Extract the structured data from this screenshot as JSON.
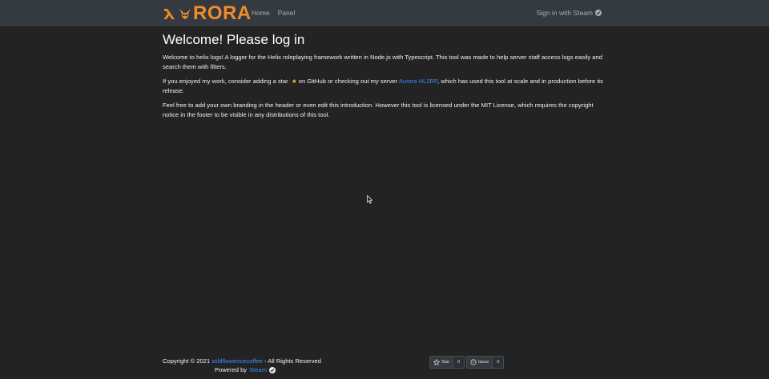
{
  "colors": {
    "accent": "#f28c28",
    "link": "#3d8bfd",
    "background": "#232323",
    "navbar": "#343a40"
  },
  "nav": {
    "brand": "RORA",
    "links": [
      {
        "label": "Home"
      },
      {
        "label": "Panel"
      }
    ],
    "signin_label": "Sign in with Steam"
  },
  "main": {
    "title": "Welcome! Please log in",
    "p1": "Welcome to helix logs! A logger for the Helix roleplaying framework written in Node.js with Typescript. This tool was made to help server staff access logs easily and search them with filters.",
    "p2_before": "If you enjoyed my work, consider adding a star",
    "p2_star": "★",
    "p2_middle": " on GitHub or checking out my server ",
    "p2_link": "Aurora HL2RP",
    "p2_after": ", which has used this tool at scale and in production before its release.",
    "p3": "Feel free to add your own branding in the header or even edit this introduction. However this tool is licensed under the MIT License, which requires the copyright notice in the footer to be visible in any distributions of this tool."
  },
  "footer": {
    "copyright_prefix": "Copyright © 2021 ",
    "author_link": "wildflowericecoffee",
    "copyright_suffix": " - All Rights Reserved",
    "powered_prefix": "Powered by ",
    "powered_link": "Steam",
    "star_label": "Star",
    "star_count": "0",
    "issue_label": "Issue",
    "issue_count": "0"
  },
  "icons": [
    "lambda-icon",
    "helmet-icon",
    "check-circle-icon",
    "star-icon",
    "github-star-icon",
    "issue-icon",
    "mouse-cursor-icon"
  ]
}
